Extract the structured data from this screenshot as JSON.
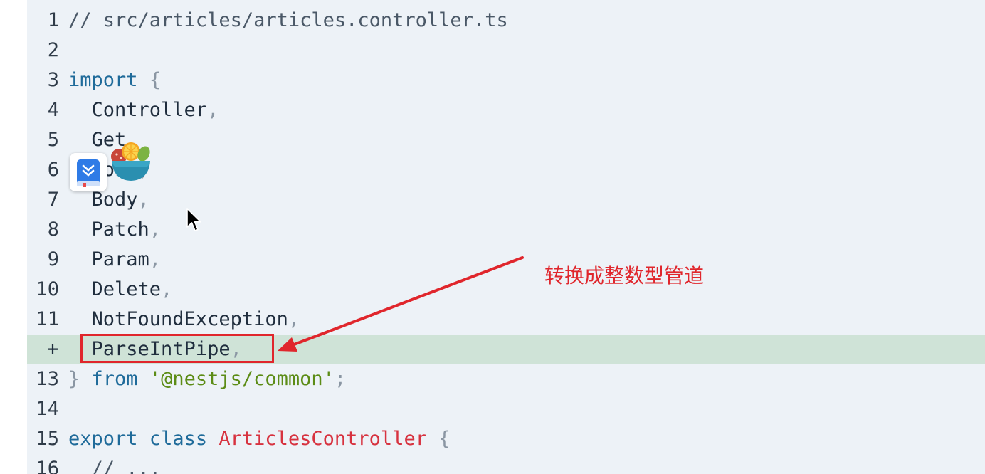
{
  "editor": {
    "lines": [
      {
        "num": "1",
        "code": [
          {
            "t": "// src/articles/articles.controller.ts",
            "c": "comment"
          }
        ]
      },
      {
        "num": "2",
        "code": []
      },
      {
        "num": "3",
        "code": [
          {
            "t": "import",
            "c": "kw"
          },
          {
            "t": " ",
            "c": ""
          },
          {
            "t": "{",
            "c": "punc"
          }
        ]
      },
      {
        "num": "4",
        "code": [
          {
            "t": "  Controller",
            "c": ""
          },
          {
            "t": ",",
            "c": "punc"
          }
        ]
      },
      {
        "num": "5",
        "code": [
          {
            "t": "  Get",
            "c": ""
          },
          {
            "t": ",",
            "c": "punc"
          }
        ]
      },
      {
        "num": "6",
        "code": [
          {
            "t": "  Post",
            "c": ""
          },
          {
            "t": ",",
            "c": "punc"
          }
        ]
      },
      {
        "num": "7",
        "code": [
          {
            "t": "  Body",
            "c": ""
          },
          {
            "t": ",",
            "c": "punc"
          }
        ]
      },
      {
        "num": "8",
        "code": [
          {
            "t": "  Patch",
            "c": ""
          },
          {
            "t": ",",
            "c": "punc"
          }
        ]
      },
      {
        "num": "9",
        "code": [
          {
            "t": "  Param",
            "c": ""
          },
          {
            "t": ",",
            "c": "punc"
          }
        ]
      },
      {
        "num": "10",
        "code": [
          {
            "t": "  Delete",
            "c": ""
          },
          {
            "t": ",",
            "c": "punc"
          }
        ]
      },
      {
        "num": "11",
        "code": [
          {
            "t": "  NotFoundException",
            "c": ""
          },
          {
            "t": ",",
            "c": "punc"
          }
        ]
      },
      {
        "num": "",
        "marker": "+",
        "added": true,
        "code": [
          {
            "t": "  ParseIntPipe",
            "c": ""
          },
          {
            "t": ",",
            "c": "punc"
          }
        ]
      },
      {
        "num": "13",
        "code": [
          {
            "t": "}",
            "c": "punc"
          },
          {
            "t": " ",
            "c": ""
          },
          {
            "t": "from",
            "c": "kw"
          },
          {
            "t": " ",
            "c": ""
          },
          {
            "t": "'@nestjs/common'",
            "c": "str"
          },
          {
            "t": ";",
            "c": "punc"
          }
        ]
      },
      {
        "num": "14",
        "code": []
      },
      {
        "num": "15",
        "code": [
          {
            "t": "export",
            "c": "kw"
          },
          {
            "t": " ",
            "c": ""
          },
          {
            "t": "class",
            "c": "kw"
          },
          {
            "t": " ",
            "c": ""
          },
          {
            "t": "ArticlesController",
            "c": "cls"
          },
          {
            "t": " ",
            "c": ""
          },
          {
            "t": "{",
            "c": "punc"
          }
        ]
      },
      {
        "num": "16",
        "code": [
          {
            "t": "  // ...",
            "c": "comment"
          }
        ]
      }
    ]
  },
  "annotation": {
    "text": "转换成整数型管道",
    "color": "#e0262c"
  },
  "overlay": {
    "popup_icon": "bookmark-book-icon",
    "fruit_icon": "fruit-bowl-icon",
    "cursor_icon": "mouse-cursor-icon"
  }
}
